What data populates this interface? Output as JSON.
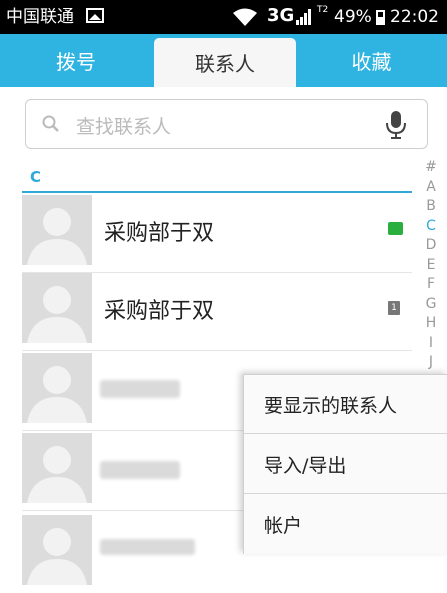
{
  "status_bar": {
    "carrier": "中国联通",
    "network": "3G",
    "sim2": "T2",
    "battery": "49%",
    "time": "22:02"
  },
  "tabs": [
    {
      "label": "拨号",
      "active": false
    },
    {
      "label": "联系人",
      "active": true
    },
    {
      "label": "收藏",
      "active": false
    }
  ],
  "search": {
    "placeholder": "查找联系人",
    "icons": [
      "search-icon",
      "microphone-icon"
    ]
  },
  "section": {
    "letter": "C"
  },
  "contacts": [
    {
      "name": "采购部于双",
      "badge": "wechat-icon"
    },
    {
      "name": "采购部于双",
      "badge": "sim1-icon",
      "badge_text": "1"
    },
    {
      "name": "",
      "blurred": true
    },
    {
      "name": "",
      "blurred": true
    },
    {
      "name": "",
      "blurred": true
    }
  ],
  "alphabet": [
    "#",
    "A",
    "B",
    "C",
    "D",
    "E",
    "F",
    "G",
    "H",
    "I",
    "J"
  ],
  "alphabet_active": "C",
  "menu": {
    "items": [
      "要显示的联系人",
      "导入/导出",
      "帐户"
    ]
  },
  "colors": {
    "accent": "#2fb4e2",
    "section": "#2fa9d8",
    "wechat": "#2aae3d"
  }
}
